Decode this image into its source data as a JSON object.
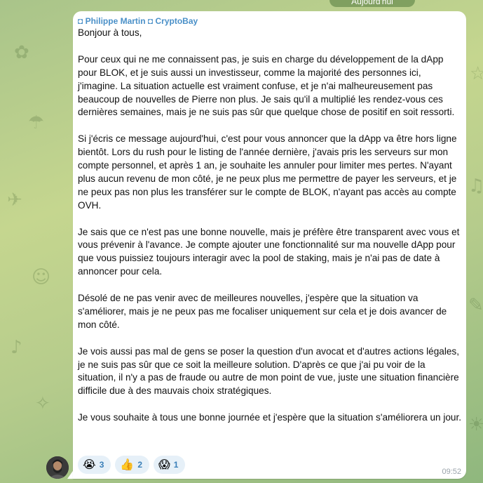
{
  "date_chip": "Aujourd'hui",
  "sender": "◘ Philippe Martin ◘ CryptoBay",
  "message_paragraphs": [
    "Bonjour à tous,",
    "Pour ceux qui ne me connaissent pas, je suis en charge du développement de la dApp pour BLOK, et je suis aussi un investisseur, comme la majorité des personnes ici, j'imagine. La situation actuelle est vraiment confuse, et je n'ai malheureusement pas beaucoup de nouvelles de Pierre non plus. Je sais qu'il a multiplié les rendez-vous ces dernières semaines, mais je ne suis pas sûr que quelque chose de positif en soit ressorti.",
    "Si j'écris ce message aujourd'hui, c'est pour vous annoncer que la dApp va être hors ligne bientôt. Lors du rush pour le listing de l'année dernière, j'avais pris les serveurs sur mon compte personnel, et après 1 an, je souhaite les annuler pour limiter mes pertes. N'ayant plus aucun revenu de mon côté, je ne peux plus me permettre de payer les serveurs, et je ne peux pas non plus les transférer sur le compte de BLOK, n'ayant pas accès au compte OVH.",
    "Je sais que ce n'est pas une bonne nouvelle, mais je préfère être transparent avec vous et vous prévenir à l'avance. Je compte ajouter une fonctionnalité sur ma nouvelle dApp pour que vous puissiez toujours interagir avec la pool de staking, mais je n'ai pas de date à annoncer pour cela.",
    "Désolé de ne pas venir avec de meilleures nouvelles, j'espère que la situation va s'améliorer, mais je ne peux pas me focaliser uniquement sur cela et je dois avancer de mon côté.",
    "Je vois aussi pas mal de gens se poser la question d'un avocat et d'autres actions légales, je ne suis pas sûr que ce soit la meilleure solution. D'après ce que j'ai pu voir de la situation, il n'y a pas de fraude ou autre de mon point de vue, juste une situation financière difficile due à des mauvais choix stratégiques.",
    "Je vous souhaite à tous une bonne journée et j'espère que la situation s'améliorera un jour."
  ],
  "reactions": [
    {
      "emoji": "😭",
      "count": "3",
      "icon": "crying-face-icon"
    },
    {
      "emoji": "👍",
      "count": "2",
      "icon": "thumbs-up-icon"
    },
    {
      "emoji": "😱",
      "count": "1",
      "icon": "screaming-face-icon"
    }
  ],
  "timestamp": "09:52",
  "colors": {
    "sender_name": "#4a90c8",
    "reaction_bg": "#e6f0f8",
    "reaction_count": "#3a7fb8",
    "bubble": "#ffffff"
  }
}
